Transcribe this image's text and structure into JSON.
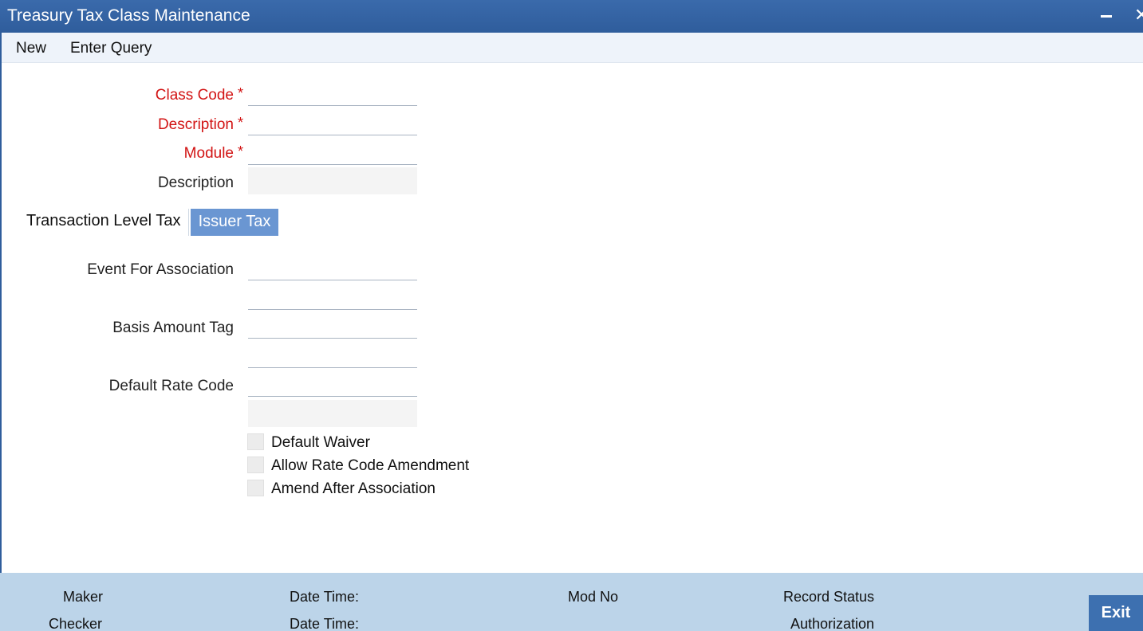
{
  "window": {
    "title": "Treasury Tax Class Maintenance",
    "minimize_icon": "minimize-icon",
    "close_icon": "close-icon",
    "close_glyph": "✕"
  },
  "menu": {
    "items": [
      "New",
      "Enter Query"
    ]
  },
  "form": {
    "class_code_label": "Class Code",
    "description_label": "Description",
    "module_label": "Module",
    "module_description_label": "Description",
    "required_marker": "*",
    "class_code_value": "",
    "description_value": "",
    "module_value": "",
    "module_description_value": ""
  },
  "tabs": {
    "items": [
      "Transaction Level Tax",
      "Issuer Tax"
    ],
    "active": "Issuer Tax"
  },
  "tax_section": {
    "event_label": "Event For Association",
    "basis_label": "Basis Amount Tag",
    "rate_code_label": "Default Rate Code",
    "event_value": "",
    "event_desc_value": "",
    "basis_value": "",
    "basis_desc_value": "",
    "rate_code_value": "",
    "rate_code_desc_value": ""
  },
  "checkboxes": [
    {
      "label": "Default Waiver",
      "checked": false
    },
    {
      "label": "Allow Rate Code Amendment",
      "checked": false
    },
    {
      "label": "Amend After Association",
      "checked": false
    }
  ],
  "footer": {
    "maker": "Maker",
    "checker": "Checker",
    "date_time_1": "Date Time:",
    "date_time_2": "Date Time:",
    "mod_no": "Mod No",
    "record_status": "Record Status",
    "authorization": "Authorization",
    "exit": "Exit"
  },
  "colors": {
    "titlebar": "#2f5d9c",
    "required": "#d21414",
    "active_tab": "#6a96d2",
    "footer": "#bcd4e9",
    "exit_button": "#3d70b0"
  }
}
